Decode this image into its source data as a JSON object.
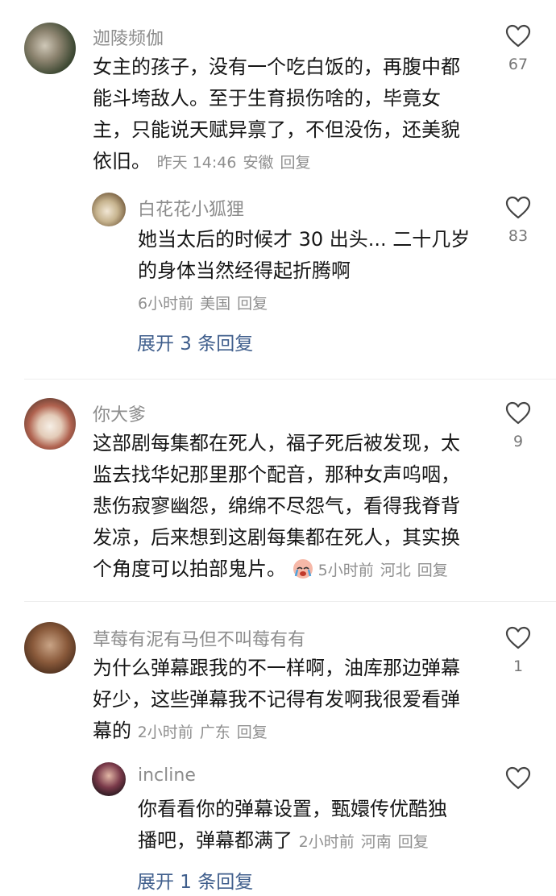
{
  "comments": [
    {
      "username": "迦陵频伽",
      "lines": [
        "女主的孩子，没有一个吃白饭的，再腹中都",
        "能斗垮敌人。至于生育损伤啥的，毕竟女",
        "主，只能说天赋异禀了，不但没伤，还美貌",
        "依旧。"
      ],
      "time": "昨天 14:46",
      "location": "安徽",
      "reply_label": "回复",
      "likes": "67",
      "replies": [
        {
          "username": "白花花小狐狸",
          "lines": [
            "她当太后的时候才 30 出头... 二十几岁",
            "的身体当然经得起折腾啊"
          ],
          "time": "6小时前",
          "location": "美国",
          "reply_label": "回复",
          "likes": "83"
        }
      ],
      "expand_label": "展开 3 条回复"
    },
    {
      "username": "你大爹",
      "lines": [
        "这部剧每集都在死人，福子死后被发现，太",
        "监去找华妃那里那个配音，那种女声呜咽，",
        "悲伤寂寥幽怨，绵绵不尽怨气，看得我脊背",
        "发凉，后来想到这剧每集都在死人，其实换",
        "个角度可以拍部鬼片。"
      ],
      "emoji": "crying-face-emoji",
      "time": "5小时前",
      "location": "河北",
      "reply_label": "回复",
      "likes": "9"
    },
    {
      "username": "草莓有泥有马但不叫莓有有",
      "lines": [
        "为什么弹幕跟我的不一样啊，油库那边弹幕",
        "好少，这些弹幕我不记得有发啊我很爱看弹",
        "幕的"
      ],
      "time": "2小时前",
      "location": "广东",
      "reply_label": "回复",
      "likes": "1",
      "replies": [
        {
          "username": "incline",
          "lines": [
            "你看看你的弹幕设置，甄嬛传优酷独",
            "播吧，弹幕都满了"
          ],
          "time": "2小时前",
          "location": "河南",
          "reply_label": "回复",
          "likes": ""
        }
      ],
      "expand_label": "展开 1 条回复"
    }
  ],
  "colors": {
    "username": "#8c8c8c",
    "meta": "#8f8f8f",
    "expand_link": "#3f5e8c",
    "heart_outline": "#444444"
  }
}
